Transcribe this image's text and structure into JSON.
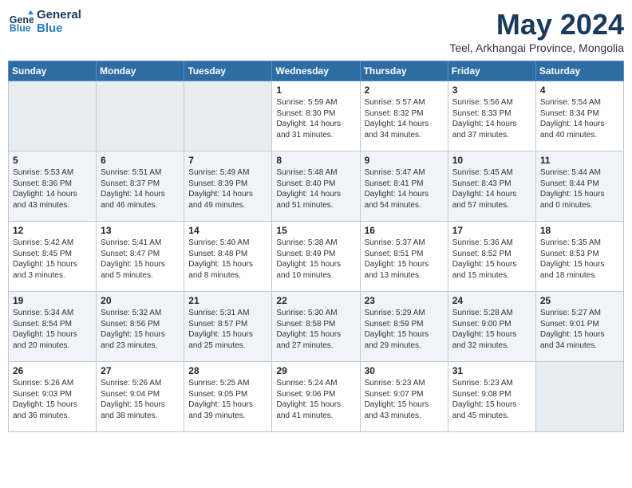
{
  "header": {
    "logo_line1": "General",
    "logo_line2": "Blue",
    "month": "May 2024",
    "location": "Teel, Arkhangai Province, Mongolia"
  },
  "weekdays": [
    "Sunday",
    "Monday",
    "Tuesday",
    "Wednesday",
    "Thursday",
    "Friday",
    "Saturday"
  ],
  "weeks": [
    [
      {
        "day": "",
        "info": ""
      },
      {
        "day": "",
        "info": ""
      },
      {
        "day": "",
        "info": ""
      },
      {
        "day": "1",
        "info": "Sunrise: 5:59 AM\nSunset: 8:30 PM\nDaylight: 14 hours\nand 31 minutes."
      },
      {
        "day": "2",
        "info": "Sunrise: 5:57 AM\nSunset: 8:32 PM\nDaylight: 14 hours\nand 34 minutes."
      },
      {
        "day": "3",
        "info": "Sunrise: 5:56 AM\nSunset: 8:33 PM\nDaylight: 14 hours\nand 37 minutes."
      },
      {
        "day": "4",
        "info": "Sunrise: 5:54 AM\nSunset: 8:34 PM\nDaylight: 14 hours\nand 40 minutes."
      }
    ],
    [
      {
        "day": "5",
        "info": "Sunrise: 5:53 AM\nSunset: 8:36 PM\nDaylight: 14 hours\nand 43 minutes."
      },
      {
        "day": "6",
        "info": "Sunrise: 5:51 AM\nSunset: 8:37 PM\nDaylight: 14 hours\nand 46 minutes."
      },
      {
        "day": "7",
        "info": "Sunrise: 5:49 AM\nSunset: 8:39 PM\nDaylight: 14 hours\nand 49 minutes."
      },
      {
        "day": "8",
        "info": "Sunrise: 5:48 AM\nSunset: 8:40 PM\nDaylight: 14 hours\nand 51 minutes."
      },
      {
        "day": "9",
        "info": "Sunrise: 5:47 AM\nSunset: 8:41 PM\nDaylight: 14 hours\nand 54 minutes."
      },
      {
        "day": "10",
        "info": "Sunrise: 5:45 AM\nSunset: 8:43 PM\nDaylight: 14 hours\nand 57 minutes."
      },
      {
        "day": "11",
        "info": "Sunrise: 5:44 AM\nSunset: 8:44 PM\nDaylight: 15 hours\nand 0 minutes."
      }
    ],
    [
      {
        "day": "12",
        "info": "Sunrise: 5:42 AM\nSunset: 8:45 PM\nDaylight: 15 hours\nand 3 minutes."
      },
      {
        "day": "13",
        "info": "Sunrise: 5:41 AM\nSunset: 8:47 PM\nDaylight: 15 hours\nand 5 minutes."
      },
      {
        "day": "14",
        "info": "Sunrise: 5:40 AM\nSunset: 8:48 PM\nDaylight: 15 hours\nand 8 minutes."
      },
      {
        "day": "15",
        "info": "Sunrise: 5:38 AM\nSunset: 8:49 PM\nDaylight: 15 hours\nand 10 minutes."
      },
      {
        "day": "16",
        "info": "Sunrise: 5:37 AM\nSunset: 8:51 PM\nDaylight: 15 hours\nand 13 minutes."
      },
      {
        "day": "17",
        "info": "Sunrise: 5:36 AM\nSunset: 8:52 PM\nDaylight: 15 hours\nand 15 minutes."
      },
      {
        "day": "18",
        "info": "Sunrise: 5:35 AM\nSunset: 8:53 PM\nDaylight: 15 hours\nand 18 minutes."
      }
    ],
    [
      {
        "day": "19",
        "info": "Sunrise: 5:34 AM\nSunset: 8:54 PM\nDaylight: 15 hours\nand 20 minutes."
      },
      {
        "day": "20",
        "info": "Sunrise: 5:32 AM\nSunset: 8:56 PM\nDaylight: 15 hours\nand 23 minutes."
      },
      {
        "day": "21",
        "info": "Sunrise: 5:31 AM\nSunset: 8:57 PM\nDaylight: 15 hours\nand 25 minutes."
      },
      {
        "day": "22",
        "info": "Sunrise: 5:30 AM\nSunset: 8:58 PM\nDaylight: 15 hours\nand 27 minutes."
      },
      {
        "day": "23",
        "info": "Sunrise: 5:29 AM\nSunset: 8:59 PM\nDaylight: 15 hours\nand 29 minutes."
      },
      {
        "day": "24",
        "info": "Sunrise: 5:28 AM\nSunset: 9:00 PM\nDaylight: 15 hours\nand 32 minutes."
      },
      {
        "day": "25",
        "info": "Sunrise: 5:27 AM\nSunset: 9:01 PM\nDaylight: 15 hours\nand 34 minutes."
      }
    ],
    [
      {
        "day": "26",
        "info": "Sunrise: 5:26 AM\nSunset: 9:03 PM\nDaylight: 15 hours\nand 36 minutes."
      },
      {
        "day": "27",
        "info": "Sunrise: 5:26 AM\nSunset: 9:04 PM\nDaylight: 15 hours\nand 38 minutes."
      },
      {
        "day": "28",
        "info": "Sunrise: 5:25 AM\nSunset: 9:05 PM\nDaylight: 15 hours\nand 39 minutes."
      },
      {
        "day": "29",
        "info": "Sunrise: 5:24 AM\nSunset: 9:06 PM\nDaylight: 15 hours\nand 41 minutes."
      },
      {
        "day": "30",
        "info": "Sunrise: 5:23 AM\nSunset: 9:07 PM\nDaylight: 15 hours\nand 43 minutes."
      },
      {
        "day": "31",
        "info": "Sunrise: 5:23 AM\nSunset: 9:08 PM\nDaylight: 15 hours\nand 45 minutes."
      },
      {
        "day": "",
        "info": ""
      }
    ]
  ]
}
